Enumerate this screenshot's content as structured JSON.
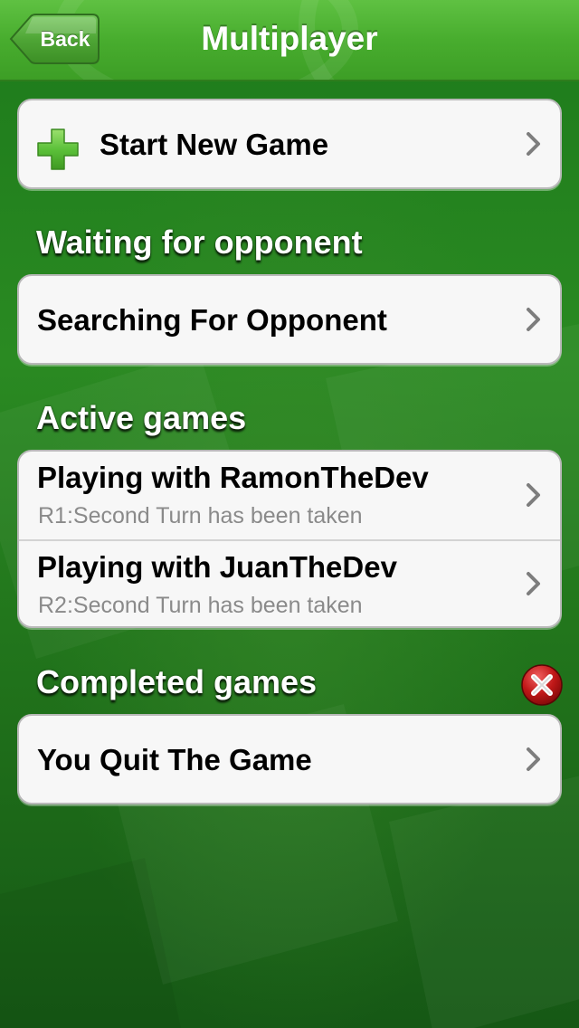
{
  "navbar": {
    "back_label": "Back",
    "title": "Multiplayer"
  },
  "start_new": {
    "label": "Start New Game",
    "icon": "plus-icon"
  },
  "sections": {
    "waiting": {
      "header": "Waiting for opponent",
      "rows": [
        {
          "title": "Searching For Opponent"
        }
      ]
    },
    "active": {
      "header": "Active games",
      "rows": [
        {
          "title": "Playing with RamonTheDev",
          "subtitle": "R1:Second Turn has been taken"
        },
        {
          "title": "Playing with JuanTheDev",
          "subtitle": "R2:Second Turn has been taken"
        }
      ]
    },
    "completed": {
      "header": "Completed games",
      "delete_icon": "close-circle-icon",
      "rows": [
        {
          "title": "You Quit The Game"
        }
      ]
    }
  },
  "colors": {
    "navbar_green": "#48ad2e",
    "background_green": "#1f7a1b",
    "plus_green": "#5cc13a",
    "delete_red": "#c01818",
    "subtitle_gray": "#8a8a8a"
  }
}
